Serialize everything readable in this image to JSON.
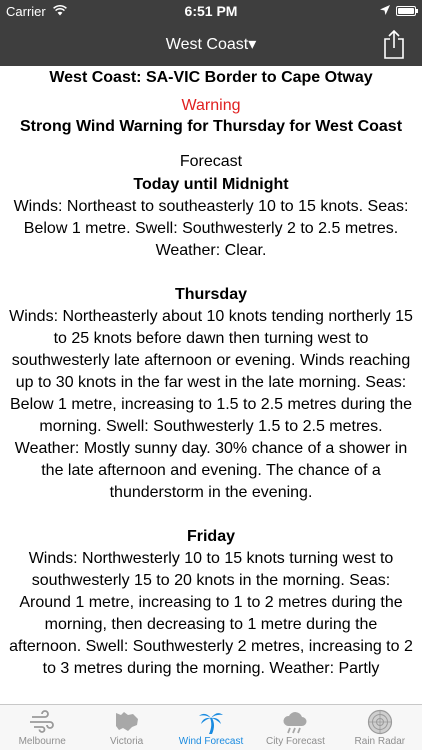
{
  "status_bar": {
    "carrier": "Carrier",
    "wifi_icon": "wifi-icon",
    "time": "6:51 PM",
    "location_icon": "location-arrow-icon",
    "battery_icon": "battery-icon"
  },
  "nav": {
    "title": "West Coast",
    "dropdown_glyph": "▾",
    "share_icon": "share-icon"
  },
  "content": {
    "region": "West Coast: SA-VIC Border to Cape Otway",
    "warning_label": "Warning",
    "warning_text": "Strong Wind Warning for Thursday for West Coast",
    "forecast_heading": "Forecast",
    "periods": [
      {
        "title": "Today until Midnight",
        "text": "Winds: Northeast to southeasterly 10 to 15 knots. Seas: Below 1 metre. Swell: Southwesterly 2 to 2.5 metres. Weather: Clear."
      },
      {
        "title": "Thursday",
        "text": "Winds: Northeasterly about 10 knots tending northerly 15 to 25 knots before dawn then turning west to southwesterly late afternoon or evening. Winds reaching up to 30 knots in the far west in the late morning. Seas: Below 1 metre, increasing to 1.5 to 2.5 metres during the morning. Swell: Southwesterly 1.5 to 2.5 metres. Weather: Mostly sunny day. 30% chance of a shower in the late afternoon and evening. The chance of a thunderstorm in the evening."
      },
      {
        "title": "Friday",
        "text": "Winds: Northwesterly 10 to 15 knots turning west to southwesterly 15 to 20 knots in the morning. Seas: Around 1 metre, increasing to 1 to 2 metres during the morning, then decreasing to 1 metre during the afternoon. Swell: Southwesterly 2 metres, increasing to 2 to 3 metres during the morning. Weather: Partly"
      }
    ]
  },
  "tabs": [
    {
      "label": "Melbourne",
      "icon": "wind-icon",
      "active": false
    },
    {
      "label": "Victoria",
      "icon": "victoria-map-icon",
      "active": false
    },
    {
      "label": "Wind Forecast",
      "icon": "palm-tree-icon",
      "active": true
    },
    {
      "label": "City Forecast",
      "icon": "rain-cloud-icon",
      "active": false
    },
    {
      "label": "Rain Radar",
      "icon": "radar-icon",
      "active": false
    }
  ],
  "colors": {
    "bar_background": "#3e3e3e",
    "warning": "#e02020",
    "tab_active": "#1a8be0",
    "tab_inactive": "#8e8e8e"
  }
}
